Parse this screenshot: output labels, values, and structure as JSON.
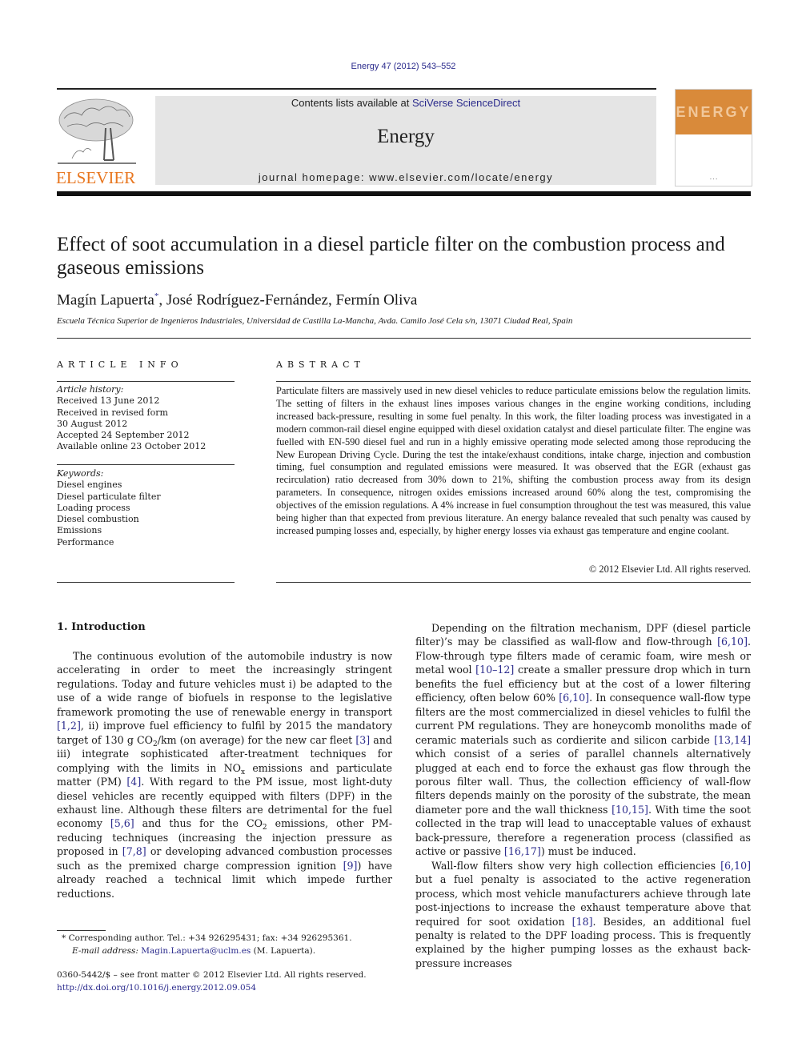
{
  "header": {
    "citation": "Energy 47 (2012) 543–552",
    "contents_prefix": "Contents lists available at ",
    "contents_link": "SciVerse ScienceDirect",
    "journal_name": "Energy",
    "homepage": "journal homepage: www.elsevier.com/locate/energy",
    "publisher_logo_text": "ELSEVIER",
    "cover_title": "ENERGY"
  },
  "colors": {
    "link": "#2a2a8c",
    "elsevier_orange": "#e8761f",
    "cover_orange": "#d98a3a",
    "banner_gray": "#e5e5e5"
  },
  "article": {
    "title": "Effect of soot accumulation in a diesel particle filter on the combustion process and gaseous emissions",
    "authors": [
      {
        "name": "Magín Lapuerta",
        "mark": "*"
      },
      {
        "name": "José Rodríguez-Fernández",
        "mark": ""
      },
      {
        "name": "Fermín Oliva",
        "mark": ""
      }
    ],
    "affiliation": "Escuela Técnica Superior de Ingenieros Industriales, Universidad de Castilla La-Mancha, Avda. Camilo José Cela s/n, 13071 Ciudad Real, Spain"
  },
  "article_info": {
    "heading": "ARTICLE INFO",
    "history_label": "Article history:",
    "history": [
      "Received 13 June 2012",
      "Received in revised form",
      "30 August 2012",
      "Accepted 24 September 2012",
      "Available online 23 October 2012"
    ],
    "keywords_label": "Keywords:",
    "keywords": [
      "Diesel engines",
      "Diesel particulate filter",
      "Loading process",
      "Diesel combustion",
      "Emissions",
      "Performance"
    ]
  },
  "abstract": {
    "heading": "ABSTRACT",
    "text": "Particulate filters are massively used in new diesel vehicles to reduce particulate emissions below the regulation limits. The setting of filters in the exhaust lines imposes various changes in the engine working conditions, including increased back-pressure, resulting in some fuel penalty. In this work, the filter loading process was investigated in a modern common-rail diesel engine equipped with diesel oxidation catalyst and diesel particulate filter. The engine was fuelled with EN-590 diesel fuel and run in a highly emissive operating mode selected among those reproducing the New European Driving Cycle. During the test the intake/exhaust conditions, intake charge, injection and combustion timing, fuel consumption and regulated emissions were measured. It was observed that the EGR (exhaust gas recirculation) ratio decreased from 30% down to 21%, shifting the combustion process away from its design parameters. In consequence, nitrogen oxides emissions increased around 60% along the test, compromising the objectives of the emission regulations. A 4% increase in fuel consumption throughout the test was measured, this value being higher than that expected from previous literature. An energy balance revealed that such penalty was caused by increased pumping losses and, especially, by higher energy losses via exhaust gas temperature and engine coolant.",
    "copyright": "© 2012 Elsevier Ltd. All rights reserved."
  },
  "body": {
    "section1_heading": "1.  Introduction",
    "left": {
      "p1": [
        {
          "t": "The continuous evolution of the automobile industry is now accelerating in order to meet the increasingly stringent regulations. Today and future vehicles must i) be adapted to the use of a wide range of biofuels in response to the legislative framework promoting the use of renewable energy in transport "
        },
        {
          "c": "[1,2]"
        },
        {
          "t": ", ii) improve fuel efficiency to fulfil by 2015 the mandatory target of 130 g CO"
        },
        {
          "s": "2"
        },
        {
          "t": "/km (on average) for the new car fleet "
        },
        {
          "c": "[3]"
        },
        {
          "t": " and iii) integrate sophisticated after-treatment techniques for complying with the limits in NO"
        },
        {
          "s": "x"
        },
        {
          "t": " emissions and particulate matter (PM) "
        },
        {
          "c": "[4]"
        },
        {
          "t": ". With regard to the PM issue, most light-duty diesel vehicles are recently equipped with filters (DPF) in the exhaust line. Although these filters are detrimental for the fuel economy "
        },
        {
          "c": "[5,6]"
        },
        {
          "t": " and thus for the CO"
        },
        {
          "s": "2"
        },
        {
          "t": " emissions, other PM-reducing techniques (increasing the injection pressure as proposed in "
        },
        {
          "c": "[7,8]"
        },
        {
          "t": " or developing advanced combustion processes such as the premixed charge compression ignition "
        },
        {
          "c": "[9]"
        },
        {
          "t": ") have already reached a technical limit which impede further reductions."
        }
      ]
    },
    "right": {
      "p1": [
        {
          "t": "Depending on the filtration mechanism, DPF (diesel particle filter)’s may be classified as wall-flow and flow-through "
        },
        {
          "c": "[6,10]"
        },
        {
          "t": ". Flow-through type filters made of ceramic foam, wire mesh or metal wool "
        },
        {
          "c": "[10–12]"
        },
        {
          "t": " create a smaller pressure drop which in turn benefits the fuel efficiency but at the cost of a lower filtering efficiency, often below 60% "
        },
        {
          "c": "[6,10]"
        },
        {
          "t": ". In consequence wall-flow type filters are the most commercialized in diesel vehicles to fulfil the current PM regulations. They are honeycomb monoliths made of ceramic materials such as cordierite and silicon carbide "
        },
        {
          "c": "[13,14]"
        },
        {
          "t": " which consist of a series of parallel channels alternatively plugged at each end to force the exhaust gas flow through the porous filter wall. Thus, the collection efficiency of wall-flow filters depends mainly on the porosity of the substrate, the mean diameter pore and the wall thickness "
        },
        {
          "c": "[10,15]"
        },
        {
          "t": ". With time the soot collected in the trap will lead to unacceptable values of exhaust back-pressure, therefore a regeneration process (classified as active or passive "
        },
        {
          "c": "[16,17]"
        },
        {
          "t": ") must be induced."
        }
      ],
      "p2": [
        {
          "t": "Wall-flow filters show very high collection efficiencies "
        },
        {
          "c": "[6,10]"
        },
        {
          "t": " but a fuel penalty is associated to the active regeneration process, which most vehicle manufacturers achieve through late post-injections to increase the exhaust temperature above that required for soot oxidation "
        },
        {
          "c": "[18]"
        },
        {
          "t": ". Besides, an additional fuel penalty is related to the DPF loading process. This is frequently explained by the higher pumping losses as the exhaust back-pressure increases"
        }
      ]
    }
  },
  "footnotes": {
    "corresponding": "*  Corresponding author. Tel.: +34 926295431; fax: +34 926295361.",
    "email_label": "E-mail address:",
    "email": "Magin.Lapuerta@uclm.es",
    "email_suffix": " (M. Lapuerta).",
    "front_matter": "0360-5442/$ – see front matter © 2012 Elsevier Ltd. All rights reserved.",
    "doi": "http://dx.doi.org/10.1016/j.energy.2012.09.054"
  }
}
